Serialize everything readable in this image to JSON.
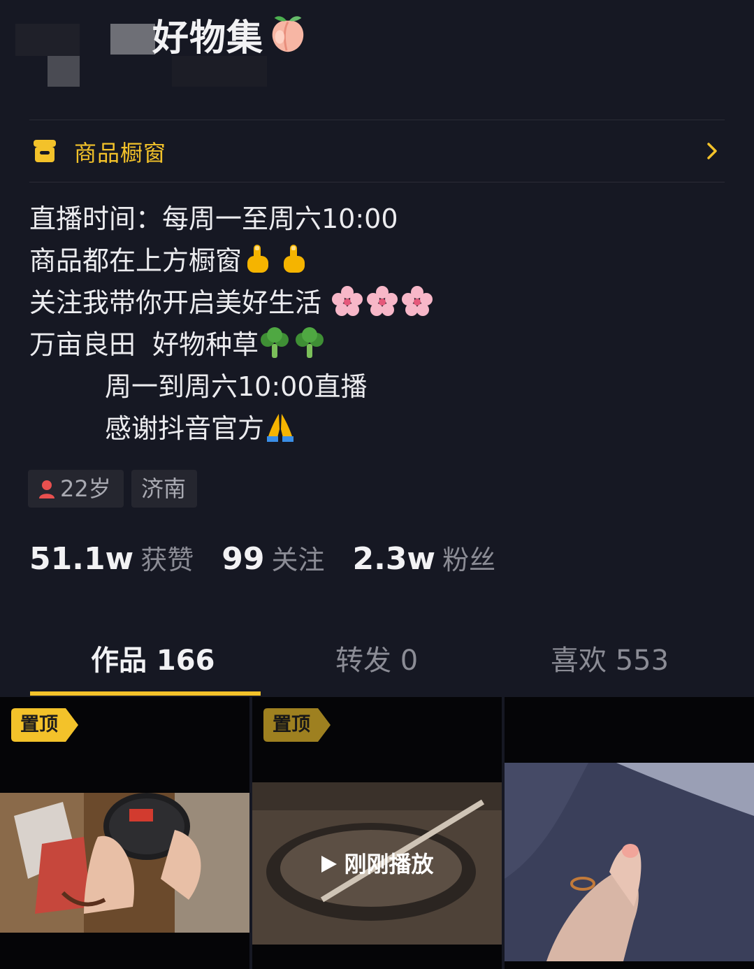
{
  "profile": {
    "name_suffix": "好物集",
    "name_emoji": "peach-emoji"
  },
  "shop": {
    "label": "商品橱窗",
    "icon": "shop-icon",
    "accent": "#f3c22a"
  },
  "bio": {
    "line1": "直播时间：每周一至周六10:00",
    "line2": "商品都在上方橱窗",
    "line3": "关注我带你开启美好生活",
    "line4": "万亩良田  好物种草",
    "line5": "周一到周六10:00直播",
    "line6": "感谢抖音官方"
  },
  "tags": {
    "age": "22岁",
    "city": "济南"
  },
  "stats": {
    "likes_num": "51.1w",
    "likes_label": "获赞",
    "following_num": "99",
    "following_label": "关注",
    "fans_num": "2.3w",
    "fans_label": "粉丝"
  },
  "tabs": {
    "works": "作品 166",
    "reposts": "转发 0",
    "likes": "喜欢 553"
  },
  "grid": {
    "pin_label": "置顶",
    "play_label": "刚刚播放"
  },
  "colors": {
    "background": "#161823",
    "accent": "#f3c22a",
    "muted": "#8b8c95"
  }
}
